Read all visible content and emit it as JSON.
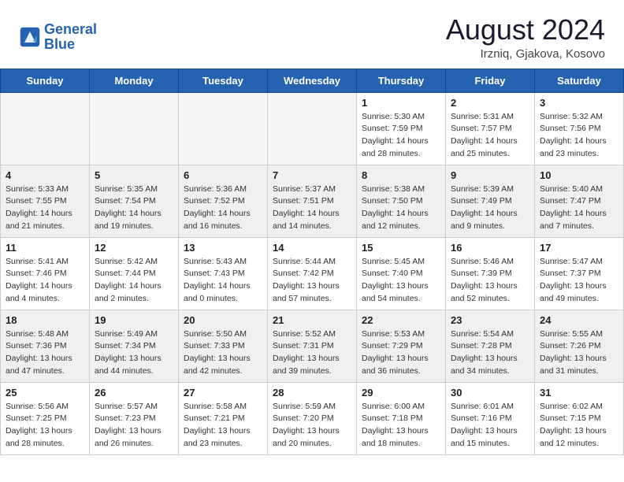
{
  "header": {
    "logo_text_1": "General",
    "logo_text_2": "Blue",
    "month_year": "August 2024",
    "location": "Irzniq, Gjakova, Kosovo"
  },
  "days_of_week": [
    "Sunday",
    "Monday",
    "Tuesday",
    "Wednesday",
    "Thursday",
    "Friday",
    "Saturday"
  ],
  "weeks": [
    {
      "shaded": false,
      "days": [
        {
          "num": "",
          "info": ""
        },
        {
          "num": "",
          "info": ""
        },
        {
          "num": "",
          "info": ""
        },
        {
          "num": "",
          "info": ""
        },
        {
          "num": "1",
          "info": "Sunrise: 5:30 AM\nSunset: 7:59 PM\nDaylight: 14 hours\nand 28 minutes."
        },
        {
          "num": "2",
          "info": "Sunrise: 5:31 AM\nSunset: 7:57 PM\nDaylight: 14 hours\nand 25 minutes."
        },
        {
          "num": "3",
          "info": "Sunrise: 5:32 AM\nSunset: 7:56 PM\nDaylight: 14 hours\nand 23 minutes."
        }
      ]
    },
    {
      "shaded": true,
      "days": [
        {
          "num": "4",
          "info": "Sunrise: 5:33 AM\nSunset: 7:55 PM\nDaylight: 14 hours\nand 21 minutes."
        },
        {
          "num": "5",
          "info": "Sunrise: 5:35 AM\nSunset: 7:54 PM\nDaylight: 14 hours\nand 19 minutes."
        },
        {
          "num": "6",
          "info": "Sunrise: 5:36 AM\nSunset: 7:52 PM\nDaylight: 14 hours\nand 16 minutes."
        },
        {
          "num": "7",
          "info": "Sunrise: 5:37 AM\nSunset: 7:51 PM\nDaylight: 14 hours\nand 14 minutes."
        },
        {
          "num": "8",
          "info": "Sunrise: 5:38 AM\nSunset: 7:50 PM\nDaylight: 14 hours\nand 12 minutes."
        },
        {
          "num": "9",
          "info": "Sunrise: 5:39 AM\nSunset: 7:49 PM\nDaylight: 14 hours\nand 9 minutes."
        },
        {
          "num": "10",
          "info": "Sunrise: 5:40 AM\nSunset: 7:47 PM\nDaylight: 14 hours\nand 7 minutes."
        }
      ]
    },
    {
      "shaded": false,
      "days": [
        {
          "num": "11",
          "info": "Sunrise: 5:41 AM\nSunset: 7:46 PM\nDaylight: 14 hours\nand 4 minutes."
        },
        {
          "num": "12",
          "info": "Sunrise: 5:42 AM\nSunset: 7:44 PM\nDaylight: 14 hours\nand 2 minutes."
        },
        {
          "num": "13",
          "info": "Sunrise: 5:43 AM\nSunset: 7:43 PM\nDaylight: 14 hours\nand 0 minutes."
        },
        {
          "num": "14",
          "info": "Sunrise: 5:44 AM\nSunset: 7:42 PM\nDaylight: 13 hours\nand 57 minutes."
        },
        {
          "num": "15",
          "info": "Sunrise: 5:45 AM\nSunset: 7:40 PM\nDaylight: 13 hours\nand 54 minutes."
        },
        {
          "num": "16",
          "info": "Sunrise: 5:46 AM\nSunset: 7:39 PM\nDaylight: 13 hours\nand 52 minutes."
        },
        {
          "num": "17",
          "info": "Sunrise: 5:47 AM\nSunset: 7:37 PM\nDaylight: 13 hours\nand 49 minutes."
        }
      ]
    },
    {
      "shaded": true,
      "days": [
        {
          "num": "18",
          "info": "Sunrise: 5:48 AM\nSunset: 7:36 PM\nDaylight: 13 hours\nand 47 minutes."
        },
        {
          "num": "19",
          "info": "Sunrise: 5:49 AM\nSunset: 7:34 PM\nDaylight: 13 hours\nand 44 minutes."
        },
        {
          "num": "20",
          "info": "Sunrise: 5:50 AM\nSunset: 7:33 PM\nDaylight: 13 hours\nand 42 minutes."
        },
        {
          "num": "21",
          "info": "Sunrise: 5:52 AM\nSunset: 7:31 PM\nDaylight: 13 hours\nand 39 minutes."
        },
        {
          "num": "22",
          "info": "Sunrise: 5:53 AM\nSunset: 7:29 PM\nDaylight: 13 hours\nand 36 minutes."
        },
        {
          "num": "23",
          "info": "Sunrise: 5:54 AM\nSunset: 7:28 PM\nDaylight: 13 hours\nand 34 minutes."
        },
        {
          "num": "24",
          "info": "Sunrise: 5:55 AM\nSunset: 7:26 PM\nDaylight: 13 hours\nand 31 minutes."
        }
      ]
    },
    {
      "shaded": false,
      "days": [
        {
          "num": "25",
          "info": "Sunrise: 5:56 AM\nSunset: 7:25 PM\nDaylight: 13 hours\nand 28 minutes."
        },
        {
          "num": "26",
          "info": "Sunrise: 5:57 AM\nSunset: 7:23 PM\nDaylight: 13 hours\nand 26 minutes."
        },
        {
          "num": "27",
          "info": "Sunrise: 5:58 AM\nSunset: 7:21 PM\nDaylight: 13 hours\nand 23 minutes."
        },
        {
          "num": "28",
          "info": "Sunrise: 5:59 AM\nSunset: 7:20 PM\nDaylight: 13 hours\nand 20 minutes."
        },
        {
          "num": "29",
          "info": "Sunrise: 6:00 AM\nSunset: 7:18 PM\nDaylight: 13 hours\nand 18 minutes."
        },
        {
          "num": "30",
          "info": "Sunrise: 6:01 AM\nSunset: 7:16 PM\nDaylight: 13 hours\nand 15 minutes."
        },
        {
          "num": "31",
          "info": "Sunrise: 6:02 AM\nSunset: 7:15 PM\nDaylight: 13 hours\nand 12 minutes."
        }
      ]
    }
  ]
}
